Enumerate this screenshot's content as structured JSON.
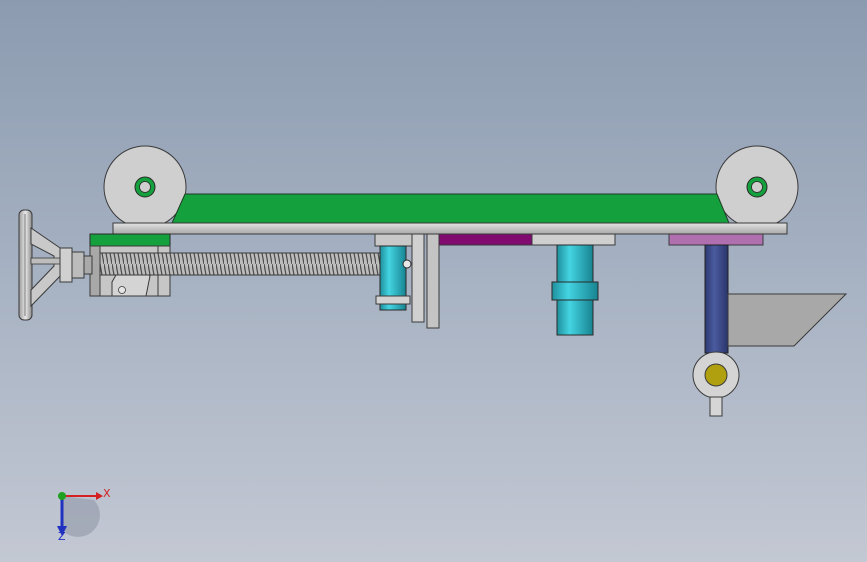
{
  "viewport": {
    "background_top": "#8c9bb0",
    "background_bottom": "#c3c8d3"
  },
  "triad": {
    "x_label": "X",
    "z_label": "Z",
    "x_color": "#d42020",
    "y_color": "#20a020",
    "z_color": "#2030c0"
  },
  "colors": {
    "belt": "#14a03c",
    "steel": "#c8c8c8",
    "cylinder": "#2ab8c8",
    "purple_plate": "#800a70",
    "lavender_plate": "#b070b0",
    "navy_post": "#3c4a8c",
    "yellow_hub": "#b0a010",
    "outline": "#3a3a3a"
  }
}
